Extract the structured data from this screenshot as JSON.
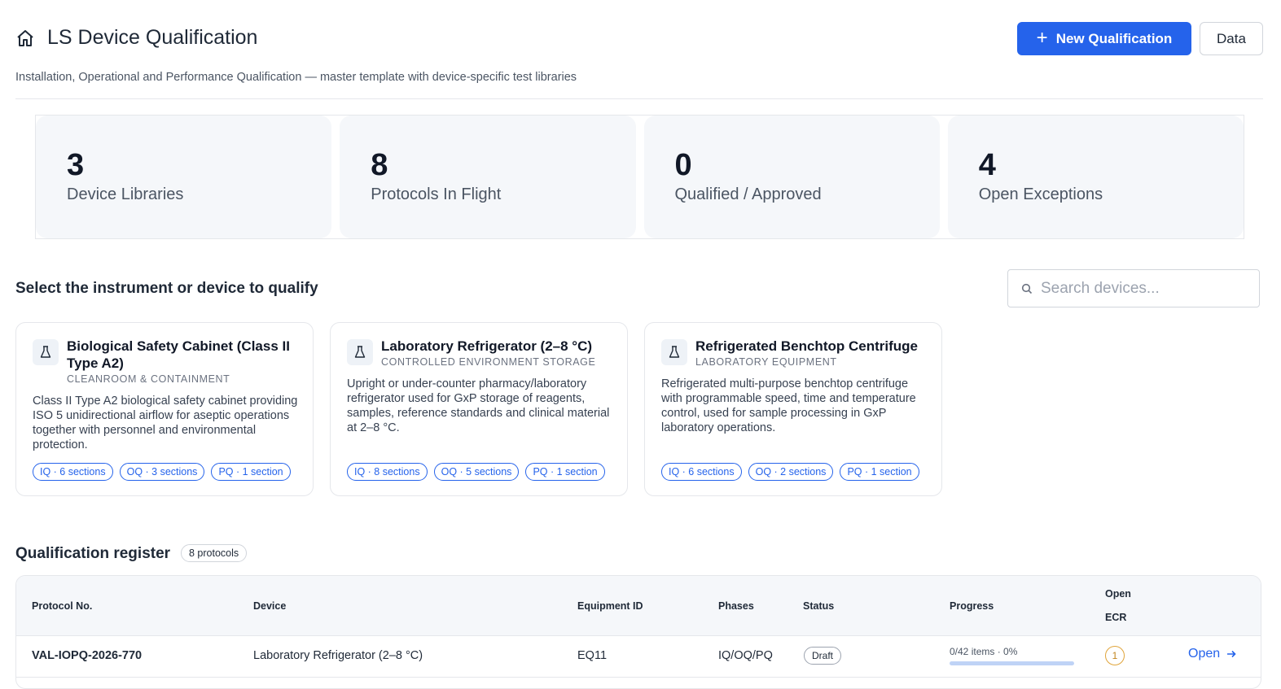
{
  "header": {
    "title": "LS Device Qualification",
    "subtitle": "Installation, Operational and Performance Qualification — master template with device-specific test libraries",
    "new_button": "New Qualification",
    "data_button": "Data"
  },
  "stats": [
    {
      "value": "3",
      "label": "Device Libraries"
    },
    {
      "value": "8",
      "label": "Protocols In Flight"
    },
    {
      "value": "0",
      "label": "Qualified / Approved"
    },
    {
      "value": "4",
      "label": "Open Exceptions"
    }
  ],
  "devices": {
    "title": "Select the instrument or device to qualify",
    "search_placeholder": "Search devices...",
    "search_value": "",
    "cards": [
      {
        "name": "Biological Safety Cabinet (Class II Type A2)",
        "category": "CLEANROOM & CONTAINMENT",
        "description": "Class II Type A2 biological safety cabinet providing ISO 5 unidirectional airflow for aseptic operations together with personnel and environmental protection.",
        "chips": [
          "IQ · 6 sections",
          "OQ · 3 sections",
          "PQ · 1 section"
        ]
      },
      {
        "name": "Laboratory Refrigerator (2–8 °C)",
        "category": "CONTROLLED ENVIRONMENT STORAGE",
        "description": "Upright or under-counter pharmacy/laboratory refrigerator used for GxP storage of reagents, samples, reference standards and clinical material at 2–8 °C.",
        "chips": [
          "IQ · 8 sections",
          "OQ · 5 sections",
          "PQ · 1 section"
        ]
      },
      {
        "name": "Refrigerated Benchtop Centrifuge",
        "category": "LABORATORY EQUIPMENT",
        "description": "Refrigerated multi-purpose benchtop centrifuge with programmable speed, time and temperature control, used for sample processing in GxP laboratory operations.",
        "chips": [
          "IQ · 6 sections",
          "OQ · 2 sections",
          "PQ · 1 section"
        ]
      }
    ]
  },
  "register": {
    "title": "Qualification register",
    "count_badge": "8 protocols",
    "columns": {
      "protocol": "Protocol No.",
      "device": "Device",
      "equipment": "Equipment ID",
      "phases": "Phases",
      "status": "Status",
      "progress": "Progress",
      "open_ecr_1": "Open",
      "open_ecr_2": "ECR"
    },
    "rows": [
      {
        "protocol": "VAL-IOPQ-2026-770",
        "device": "Laboratory Refrigerator (2–8 °C)",
        "equipment": "EQ11",
        "phases": "IQ/OQ/PQ",
        "status": "Draft",
        "progress_text": "0/42 items · 0%",
        "progress_fraction": 0,
        "open_ecr": "1",
        "action": "Open"
      }
    ]
  },
  "colors": {
    "accent": "#2563eb",
    "stat_bg": "#f5f7fa",
    "ecr_warning": "#e0a43a"
  },
  "icons": [
    "home-icon",
    "plus-icon",
    "search-icon",
    "flask-icon",
    "arrow-right-icon"
  ]
}
